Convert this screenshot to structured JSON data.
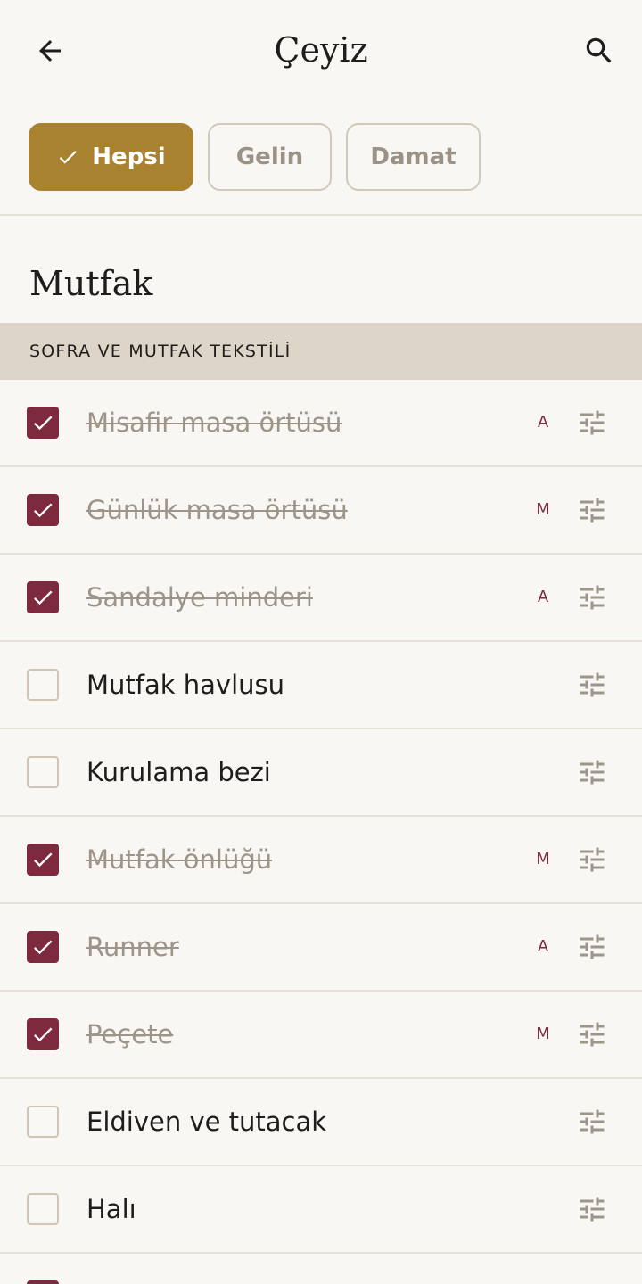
{
  "header": {
    "title": "Çeyiz",
    "back_icon": "arrow-back-icon",
    "search_icon": "search-icon"
  },
  "filters": {
    "items": [
      {
        "label": "Hepsi",
        "selected": true
      },
      {
        "label": "Gelin",
        "selected": false
      },
      {
        "label": "Damat",
        "selected": false
      }
    ]
  },
  "section": {
    "title": "Mutfak",
    "subheader": "SOFRA VE MUTFAK TEKSTİLİ"
  },
  "items": [
    {
      "label": "Misafir masa örtüsü",
      "checked": true,
      "assignee": "A"
    },
    {
      "label": "Günlük masa örtüsü",
      "checked": true,
      "assignee": "M"
    },
    {
      "label": "Sandalye minderi",
      "checked": true,
      "assignee": "A"
    },
    {
      "label": "Mutfak havlusu",
      "checked": false,
      "assignee": ""
    },
    {
      "label": "Kurulama bezi",
      "checked": false,
      "assignee": ""
    },
    {
      "label": "Mutfak önlüğü",
      "checked": true,
      "assignee": "M"
    },
    {
      "label": "Runner",
      "checked": true,
      "assignee": "A"
    },
    {
      "label": "Peçete",
      "checked": true,
      "assignee": "M"
    },
    {
      "label": "Eldiven ve tutacak",
      "checked": false,
      "assignee": ""
    },
    {
      "label": "Halı",
      "checked": false,
      "assignee": ""
    }
  ],
  "partial_item": {
    "checked": true
  },
  "colors": {
    "background": "#f9f7f3",
    "accent_gold": "#a8822e",
    "accent_wine": "#7d2a3e",
    "subheader_bg": "#ddd5c8",
    "muted_text": "#9d958a"
  }
}
